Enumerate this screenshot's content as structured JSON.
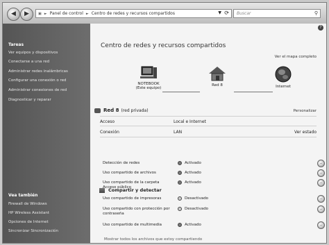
{
  "address": {
    "crumbs": [
      "Panel de control",
      "Centro de redes y recursos compartidos"
    ],
    "search_placeholder": "Buscar"
  },
  "sidebar": {
    "tasks_header": "Tareas",
    "tasks": [
      "Ver equipos y dispositivos",
      "Conectarse a una red",
      "Administrar redes inalámbricas",
      "Configurar una conexión o red",
      "Administrar conexiones de red",
      "Diagnosticar y reparar"
    ],
    "see_also_header": "Vea también",
    "see_also": [
      "Firewall de Windows",
      "HP Wireless Assistant",
      "Opciones de Internet",
      "Sincronizar Sincronización"
    ]
  },
  "main": {
    "title": "Centro de redes y recursos compartidos",
    "full_map_link": "Ver el mapa completo",
    "nodes": [
      {
        "name": "NOTEBOOK",
        "sub": "(Este equipo)",
        "icon": "computer-icon"
      },
      {
        "name": "Red 8",
        "sub": "",
        "icon": "house-network-icon"
      },
      {
        "name": "Internet",
        "sub": "",
        "icon": "globe-icon"
      }
    ],
    "network": {
      "name": "Red 8",
      "type": "(red privada)",
      "customize": "Personalizar",
      "rows": [
        {
          "label": "Acceso",
          "value": "Local e Internet",
          "action": ""
        },
        {
          "label": "Conexión",
          "value": "LAN",
          "action": "Ver estado"
        }
      ]
    },
    "sharing": {
      "header": "Compartir y detectar",
      "rows": [
        {
          "label": "Detección de redes",
          "status": "Activado",
          "on": true
        },
        {
          "label": "Uso compartido de archivos",
          "status": "Activado",
          "on": true
        },
        {
          "label": "Uso compartido de la carpeta Acceso público",
          "status": "Activado",
          "on": true
        },
        {
          "label": "Uso compartido de impresoras",
          "status": "Desactivado",
          "on": false
        },
        {
          "label": "Uso compartido con protección por contraseña",
          "status": "Desactivado",
          "on": false
        },
        {
          "label": "Uso compartido de multimedia",
          "status": "Activado",
          "on": true
        }
      ]
    },
    "show_all": "Mostrar todos los archivos que estoy compartiendo"
  }
}
